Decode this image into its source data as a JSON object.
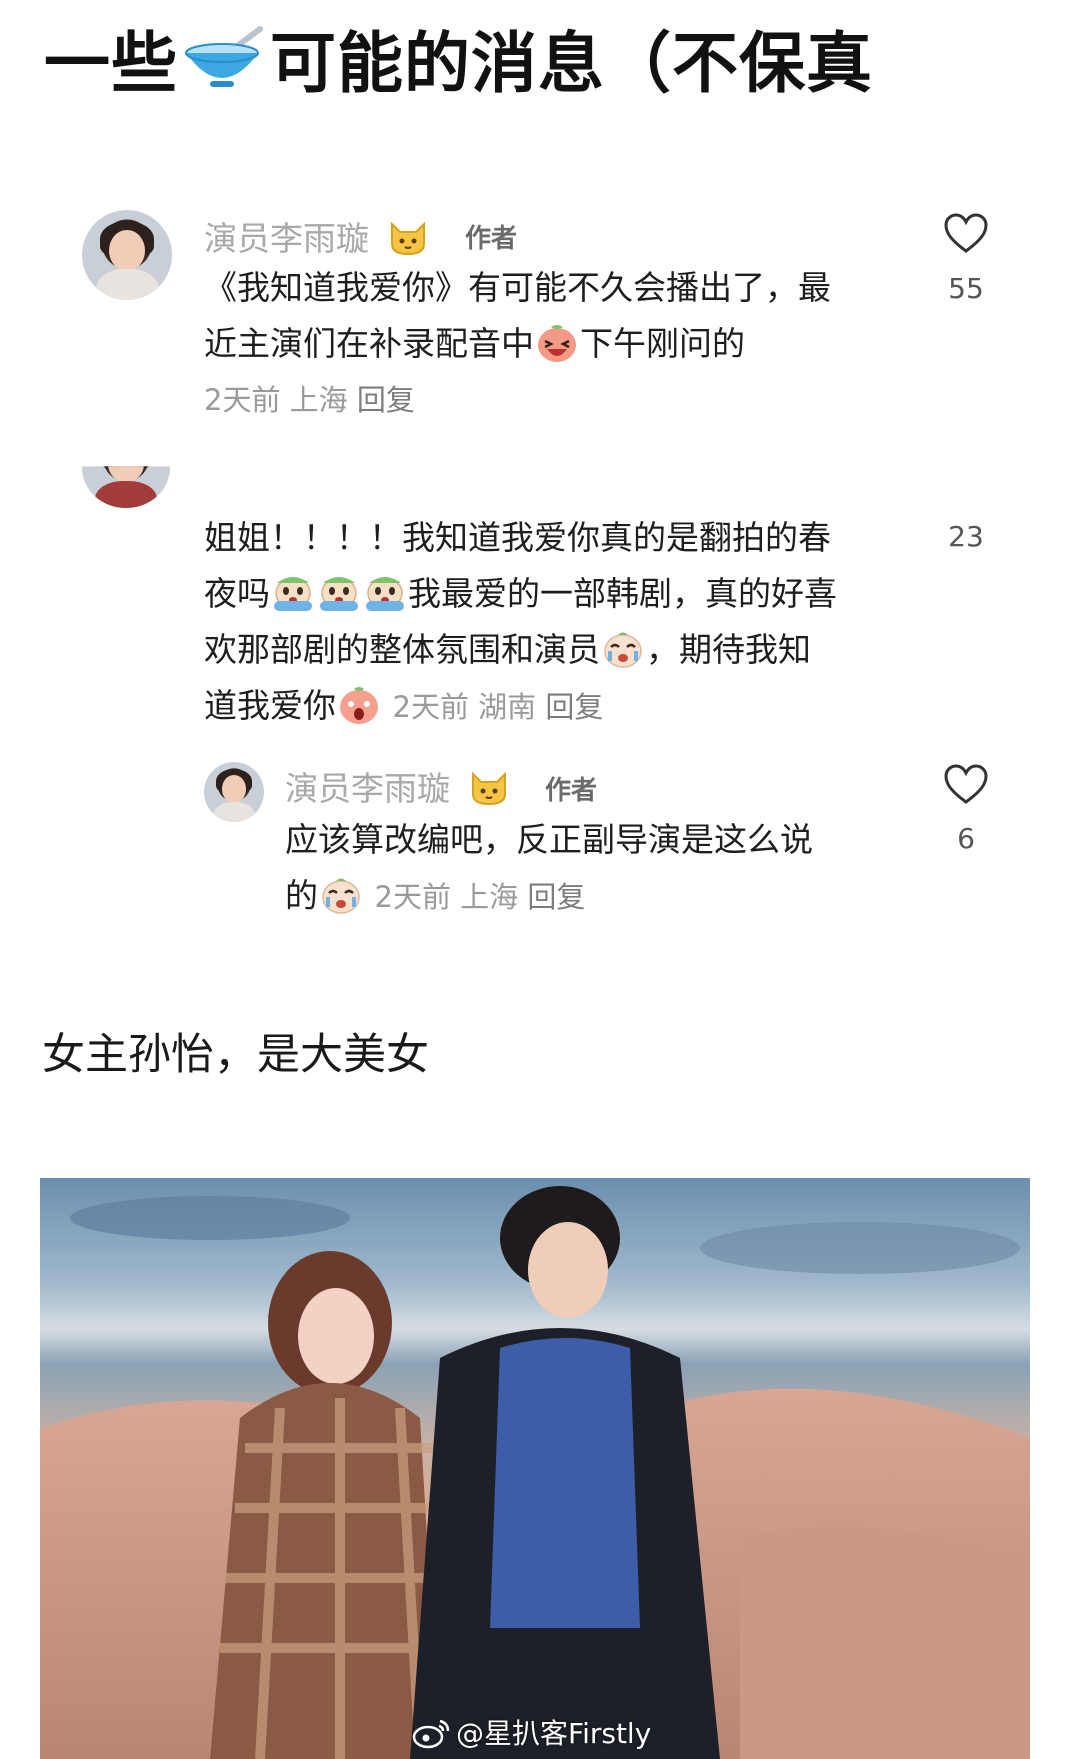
{
  "title": {
    "before": "一些",
    "after": "可能的消息（不保真",
    "emoji_icon": "bowl-icon"
  },
  "comments": [
    {
      "author": "演员李雨璇",
      "badge_icon": "cat-icon",
      "tag": "作者",
      "text_line1": "《我知道我爱你》有可能不久会播出了，最",
      "text_line2a": "近主演们在补录配音中",
      "text_line2b": "下午刚问的",
      "emoji": "laughing-emoji",
      "time": "2天前",
      "location": "上海",
      "reply": "回复",
      "likes": "55"
    },
    {
      "line1": "姐姐！！！！我知道我爱你真的是翻拍的春",
      "line2_after": "我最爱的一部韩剧，真的好喜",
      "line3a": "欢那部剧的整体氛围和演员",
      "line3b": "，期待我知",
      "line4": "道我爱你",
      "emojis": [
        "crying-emoji",
        "crying-emoji",
        "crying-emoji",
        "tearful-emoji",
        "shocked-emoji"
      ],
      "line2_before": "夜吗",
      "time": "2天前",
      "location": "湖南",
      "reply": "回复",
      "likes": "23"
    },
    {
      "author": "演员李雨璇",
      "badge_icon": "cat-icon",
      "tag": "作者",
      "line1": "应该算改编吧，反正副导演是这么说",
      "line2": "的",
      "emoji": "tearful-emoji",
      "time": "2天前",
      "location": "上海",
      "reply": "回复",
      "likes": "6"
    }
  ],
  "subheading": "女主孙怡，是大美女",
  "watermark": {
    "text": "@星扒客Firstly",
    "icon": "weibo-icon"
  },
  "colors": {
    "text": "#1e1e1e",
    "muted": "#a8a8a8",
    "meta": "#9a9a9a",
    "background": "#ffffff"
  }
}
